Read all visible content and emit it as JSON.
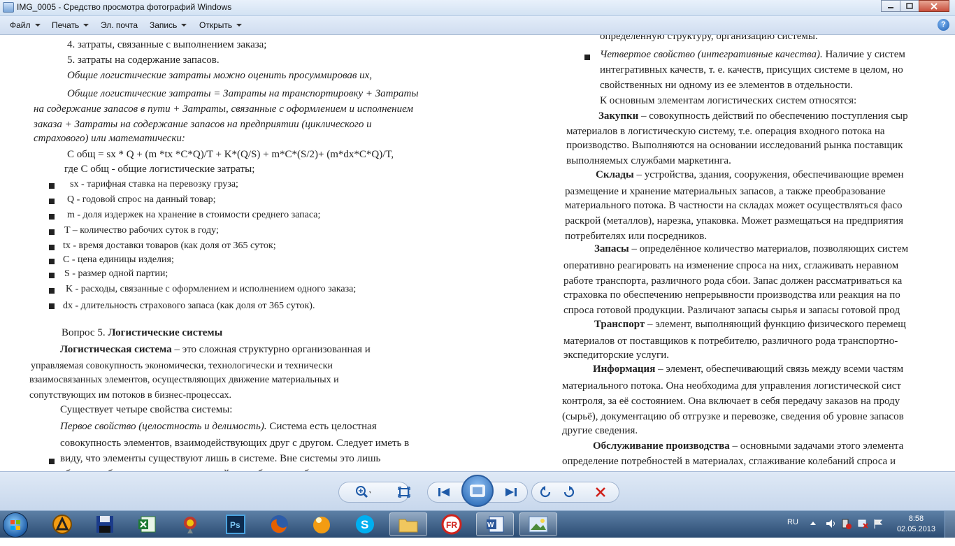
{
  "window": {
    "title": "IMG_0005 - Средство просмотра фотографий Windows",
    "minimize_label": "–",
    "maximize_label": "□",
    "close_label": "✕"
  },
  "menu": {
    "file": "Файл",
    "print": "Печать",
    "email": "Эл. почта",
    "burn": "Запись",
    "open": "Открыть",
    "help": "?"
  },
  "document": {
    "left": [
      "4. затраты, связанные с выполнением заказа;",
      "5. затраты на содержание запасов.",
      "Общие логистические затраты можно оценить просуммировав их,",
      "Общие логистические затраты = Затраты на транспортировку + Затраты",
      "на содержание запасов в пути + Затраты, связанные с оформлением и исполнением",
      "заказа + Затраты на содержание запасов на предприятии (циклического и",
      "страхового)     или математически:",
      "С общ = sx * Q + (m *tx *C*Q)/T + K*(Q/S) + m*C*(S/2)+ (m*dx*C*Q)/T,",
      "где С общ - общие логистические затраты;",
      "sx - тарифная ставка на перевозку груза;",
      "Q - годовой спрос на данный товар;",
      "m  - доля издержек на хранение в стоимости среднего запаса;",
      "T – количество рабочих суток в году;",
      "tx - время доставки товаров (как доля от 365 суток;",
      "C - цена единицы изделия;",
      "S - размер одной партии;",
      "K  - расходы, связанные с оформлением и исполнением одного заказа;",
      "dx - длительность страхового запаса (как доля от 365 суток).",
      "Вопрос 5. Логистические системы",
      "Логистическая система – это сложная структурно организованная и",
      "управляемая совокупность  экономически, технологически и технически",
      "взаимосвязанных элементов, осуществляющих движение материальных и",
      "сопутствующих им потоков в бизнес-процессах.",
      "Существует четыре свойства системы:",
      "Первое свойство (целостность и делимость). Система есть целостная",
      "совокупность элементов, взаимодействующих друг с другом. Следует иметь в",
      "виду, что элементы существуют лишь в системе. Вне системы это лишь",
      "объекты, обладающие потенциальной способностью образования системы."
    ],
    "right": [
      "определенную структуру, организацию системы.",
      "Четвертое свойство (интегративные качества). Наличие у систем",
      "интегративных качеств, т. е. качеств, присущих системе в целом, но",
      "свойственных ни одному из ее элементов в отдельности.",
      "К основным элементам логистических систем относятся:",
      "Закупки – совокупность действий по обеспечению поступления сыр",
      "материалов в логистическую систему, т.е. операция входного потока на",
      "производство. Выполняются на основании исследований рынка поставщик",
      "выполняемых службами маркетинга.",
      "Склады – устройства, здания, сооружения, обеспечивающие времен",
      "размещение и хранение материальных запасов,  а также преобразование",
      "материального потока. В частности на складах может осуществляться фасо",
      "раскрой (металлов), нарезка, упаковка. Может размещаться на предприятия",
      "потребителях или посредников.",
      "Запасы – определённое количество материалов, позволяющих систем",
      "оперативно реагировать на изменение спроса на них, сглаживать неравном",
      "работе транспорта, различного рода сбои. Запас должен рассматриваться ка",
      "страховка по обеспечению непрерывности производства или реакция на по",
      "спроса готовой продукции. Различают запасы сырья и запасы готовой прод",
      "Транспорт – элемент, выполняющий функцию физического перемещ",
      "материалов от поставщиков к потребителю, различного рода транспортно-",
      "экспедиторские услуги.",
      "Информация – элемент, обеспечивающий связь между всеми частям",
      "материального потока. Она необходима для управления логистической сист",
      "контроля, за её состоянием. Она включает в себя передачу заказов на проду",
      "(сырьё), документацию об отгрузке и перевозке, сведения об уровне запасов",
      "другие сведения.",
      "Обслуживание производства – основными задачами этого элемента",
      "определение потребностей в материалах, сглаживание колебаний спроса и"
    ]
  },
  "toolbar": {
    "zoom": "zoom-icon",
    "fit": "actual-size-icon",
    "prev": "previous-icon",
    "slideshow": "slideshow-icon",
    "next": "next-icon",
    "rotate_left": "rotate-ccw-icon",
    "rotate_right": "rotate-cw-icon",
    "delete": "delete-icon"
  },
  "taskbar": {
    "language": "RU",
    "time": "8:58",
    "date": "02.05.2013"
  }
}
